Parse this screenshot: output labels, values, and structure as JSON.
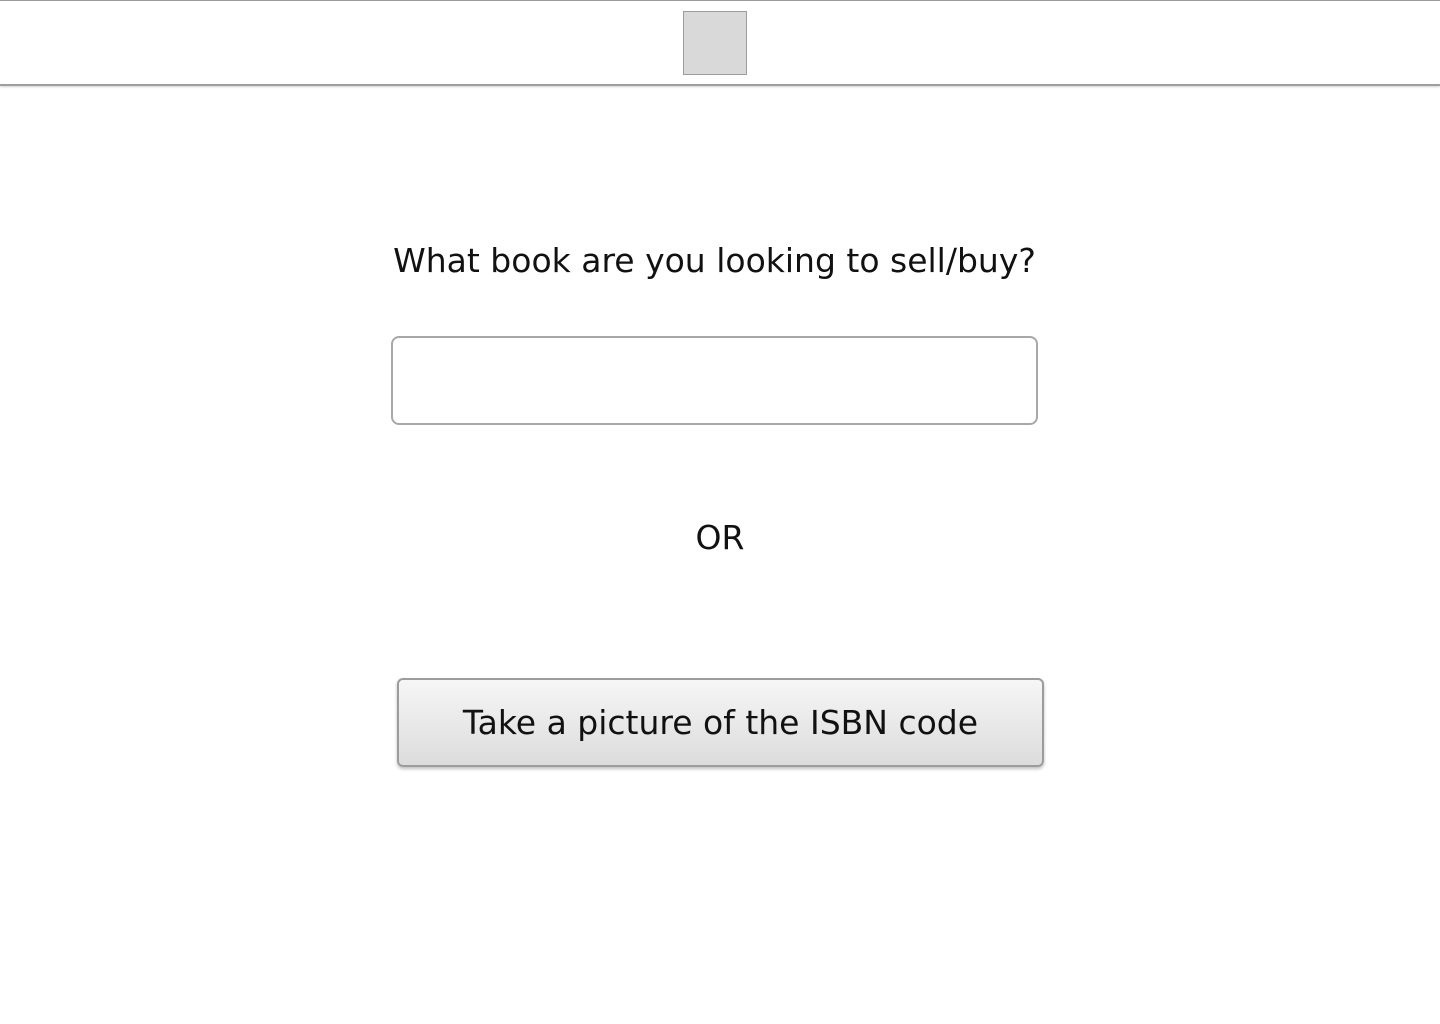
{
  "header": {
    "logo_icon": "placeholder-image-icon"
  },
  "main": {
    "question": "What book are you looking to sell/buy?",
    "search": {
      "value": "",
      "placeholder": ""
    },
    "separator": "OR",
    "isbn_button_label": "Take a picture of the ISBN code"
  }
}
